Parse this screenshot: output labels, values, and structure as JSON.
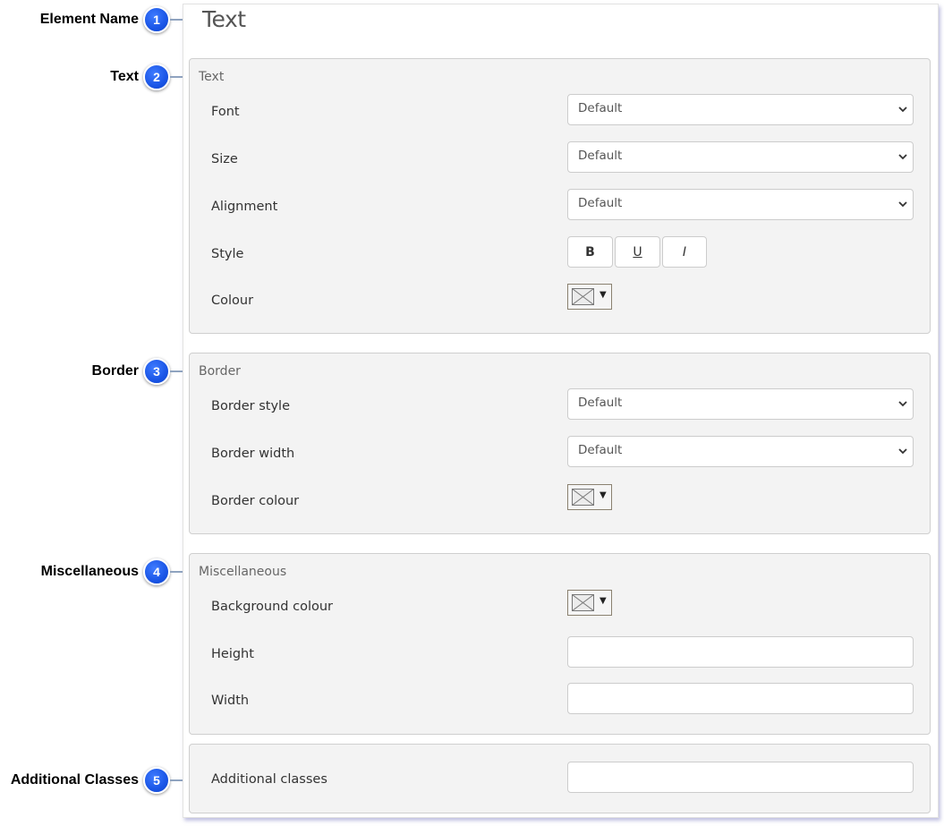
{
  "callouts": [
    {
      "number": "1",
      "label": "Element Name"
    },
    {
      "number": "2",
      "label": "Text"
    },
    {
      "number": "3",
      "label": "Border"
    },
    {
      "number": "4",
      "label": "Miscellaneous"
    },
    {
      "number": "5",
      "label": "Additional Classes"
    }
  ],
  "panel": {
    "title": "Text"
  },
  "text_group": {
    "legend": "Text",
    "font": {
      "label": "Font",
      "value": "Default"
    },
    "size": {
      "label": "Size",
      "value": "Default"
    },
    "alignment": {
      "label": "Alignment",
      "value": "Default"
    },
    "style": {
      "label": "Style",
      "bold": "B",
      "underline": "U",
      "italic": "I"
    },
    "colour": {
      "label": "Colour",
      "caret": "▼"
    }
  },
  "border_group": {
    "legend": "Border",
    "border_style": {
      "label": "Border style",
      "value": "Default"
    },
    "border_width": {
      "label": "Border width",
      "value": "Default"
    },
    "border_colour": {
      "label": "Border colour",
      "caret": "▼"
    }
  },
  "misc_group": {
    "legend": "Miscellaneous",
    "background_colour": {
      "label": "Background colour",
      "caret": "▼"
    },
    "height": {
      "label": "Height",
      "value": ""
    },
    "width": {
      "label": "Width",
      "value": ""
    }
  },
  "classes_group": {
    "additional_classes": {
      "label": "Additional classes",
      "value": ""
    }
  },
  "colors": {
    "badge": "#1a55e6",
    "group_bg": "#f3f3f3",
    "panel_shadow": "#8c8cc8"
  },
  "icons": {
    "select_arrow": "chevron-down-icon",
    "colour_swatch": "no-colour-swatch-icon"
  }
}
